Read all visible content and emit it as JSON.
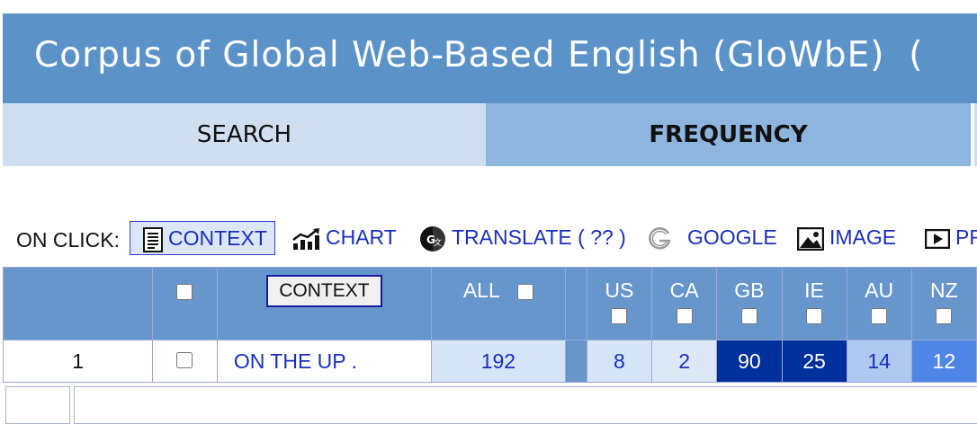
{
  "header": {
    "title": "Corpus of Global Web-Based English (GloWbE)",
    "title_overflow": "("
  },
  "nav": {
    "tabs": [
      {
        "label": "SEARCH"
      },
      {
        "label": "FREQUENCY"
      }
    ]
  },
  "on_click": {
    "label": "ON CLICK:",
    "options": [
      {
        "label": "CONTEXT",
        "icon": "document-icon",
        "selected": true
      },
      {
        "label": "CHART",
        "icon": "chart-icon"
      },
      {
        "label": "TRANSLATE  ( ?? )",
        "icon": "translate-icon"
      },
      {
        "label": "GOOGLE",
        "icon": "google-icon"
      },
      {
        "label": "IMAGE",
        "icon": "image-icon"
      },
      {
        "label": "PR",
        "icon": "play-icon"
      }
    ]
  },
  "table": {
    "context_button": "CONTEXT",
    "all_label": "ALL",
    "columns": [
      "US",
      "CA",
      "GB",
      "IE",
      "AU",
      "NZ"
    ],
    "rows": [
      {
        "num": "1",
        "word": "ON THE UP .",
        "all": "192",
        "counts": [
          "8",
          "2",
          "90",
          "25",
          "14",
          "12"
        ]
      }
    ]
  },
  "colors": {
    "header": "#5b92c8",
    "tab_inactive": "#cfdff0",
    "tab_active": "#8eb5de",
    "table_header": "#6696cb",
    "link": "#1a2fbf",
    "high": "#00309b"
  }
}
